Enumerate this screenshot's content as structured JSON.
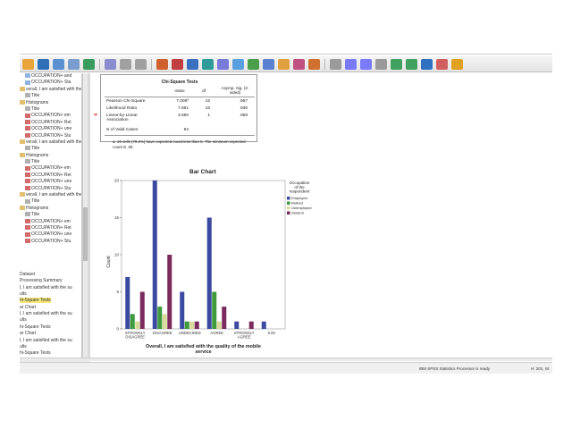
{
  "status": {
    "message": "IBM SPSS Statistics Processor is ready",
    "position": "H: 201, W:"
  },
  "toolbar": {
    "icons": [
      "open-icon",
      "save-icon",
      "print-icon",
      "print-preview-icon",
      "export-icon",
      "recall-icon",
      "undo-icon",
      "redo-icon",
      "goto-data-icon",
      "goto-case-icon",
      "goto-variable-icon",
      "variables-icon",
      "find-icon",
      "insert-cases-icon",
      "insert-variable-icon",
      "split-file-icon",
      "weight-cases-icon",
      "select-cases-icon",
      "value-labels-icon",
      "show-all-icon",
      "spelling-icon",
      "collapse-icon",
      "expand-icon",
      "promote-icon",
      "demote-icon",
      "insert-heading-icon",
      "insert-title-icon",
      "insert-text-icon"
    ]
  },
  "outline": [
    {
      "label": "OCCUPATION+ and",
      "icon": "table"
    },
    {
      "label": "OCCUPATION+ Sta",
      "icon": "table"
    },
    {
      "label": "verall, I am satisfied with the",
      "icon": "book"
    },
    {
      "label": "Title",
      "icon": "page"
    },
    {
      "label": "Histograms",
      "icon": "book"
    },
    {
      "label": "Title",
      "icon": "page"
    },
    {
      "label": "OCCUPATION+ em",
      "icon": "chart"
    },
    {
      "label": "OCCUPATION+ Ret",
      "icon": "chart"
    },
    {
      "label": "OCCUPATION+ une",
      "icon": "chart"
    },
    {
      "label": "OCCUPATION+ Stu",
      "icon": "chart"
    },
    {
      "label": "verall, I am satisfied with the",
      "icon": "book"
    },
    {
      "label": "Title",
      "icon": "page"
    },
    {
      "label": "Histograms",
      "icon": "book"
    },
    {
      "label": "Title",
      "icon": "page"
    },
    {
      "label": "OCCUPATION+ em",
      "icon": "chart"
    },
    {
      "label": "OCCUPATION+ Ret",
      "icon": "chart"
    },
    {
      "label": "OCCUPATION+ une",
      "icon": "chart"
    },
    {
      "label": "OCCUPATION+ Stu",
      "icon": "chart"
    },
    {
      "label": "verall, I am satisfied with the W",
      "icon": "book"
    },
    {
      "label": "Title",
      "icon": "page"
    },
    {
      "label": "Histograms",
      "icon": "book"
    },
    {
      "label": "Title",
      "icon": "page"
    },
    {
      "label": "OCCUPATION+ em",
      "icon": "chart"
    },
    {
      "label": "OCCUPATION+ Ret",
      "icon": "chart"
    },
    {
      "label": "OCCUPATION+ une",
      "icon": "chart"
    },
    {
      "label": "OCCUPATION+ Stu",
      "icon": "chart"
    },
    {
      "label": "",
      "icon": ""
    },
    {
      "label": "",
      "icon": ""
    },
    {
      "label": "",
      "icon": ""
    },
    {
      "label": "",
      "icon": ""
    },
    {
      "label": "Dataset",
      "icon": ""
    },
    {
      "label": "Processing Summary",
      "icon": ""
    },
    {
      "label": "l, I am satisfied with the su",
      "icon": ""
    },
    {
      "label": "ults",
      "icon": ""
    },
    {
      "label": "hi-Square Tests",
      "icon": "",
      "highlight": true
    },
    {
      "label": "ar Chart",
      "icon": ""
    },
    {
      "label": "l, I am satisfied with the su",
      "icon": ""
    },
    {
      "label": "ults",
      "icon": ""
    },
    {
      "label": "hi-Square Tests",
      "icon": ""
    },
    {
      "label": "ar Chart",
      "icon": ""
    },
    {
      "label": "l, I am satisfied with the su",
      "icon": ""
    },
    {
      "label": "ults",
      "icon": ""
    },
    {
      "label": "hi-Square Tests",
      "icon": ""
    }
  ],
  "chi_table": {
    "title": "Chi-Square Tests",
    "headers": [
      "Value",
      "df",
      "Asymp. Sig. (2-sided)"
    ],
    "rows": [
      {
        "label": "Pearson Chi-Square",
        "value": "7.008ª",
        "df": "15",
        "sig": ".957"
      },
      {
        "label": "Likelihood Ratio",
        "value": "7.681",
        "df": "15",
        "sig": ".936"
      },
      {
        "label": "Linear-by-Linear Association",
        "value": "3.590",
        "df": "1",
        "sig": ".058"
      },
      {
        "label": "N of Valid Cases",
        "value": "84",
        "df": "",
        "sig": ""
      }
    ],
    "footnote": "a. 19 cells (79.2%) have expected count less than 5. The minimum expected count is .05."
  },
  "chart_data": {
    "type": "bar",
    "title": "Bar Chart",
    "xlabel": "Overall, I am satisfied with the quality of the mobile service",
    "ylabel": "Count",
    "ylim": [
      0,
      20
    ],
    "yticks": [
      0,
      5,
      10,
      15,
      20
    ],
    "legend_title": "Occupation of the respondent",
    "categories": [
      "STRONGLY DISAGREE",
      "DISAGREE",
      "UNDECIDED",
      "AGREE",
      "STRONGLY AGREE",
      "6.00"
    ],
    "series": [
      {
        "name": "Employed",
        "color": "#3b4aa0",
        "values": [
          7,
          20,
          5,
          15,
          1,
          1
        ]
      },
      {
        "name": "Retired",
        "color": "#3f9a3c",
        "values": [
          2,
          3,
          1,
          5,
          0,
          0
        ]
      },
      {
        "name": "Unemployed",
        "color": "#d8dc9a",
        "values": [
          1,
          2,
          1,
          1,
          0,
          0
        ]
      },
      {
        "name": "Student",
        "color": "#7a2a5c",
        "values": [
          5,
          10,
          1,
          3,
          1,
          0
        ]
      }
    ]
  }
}
